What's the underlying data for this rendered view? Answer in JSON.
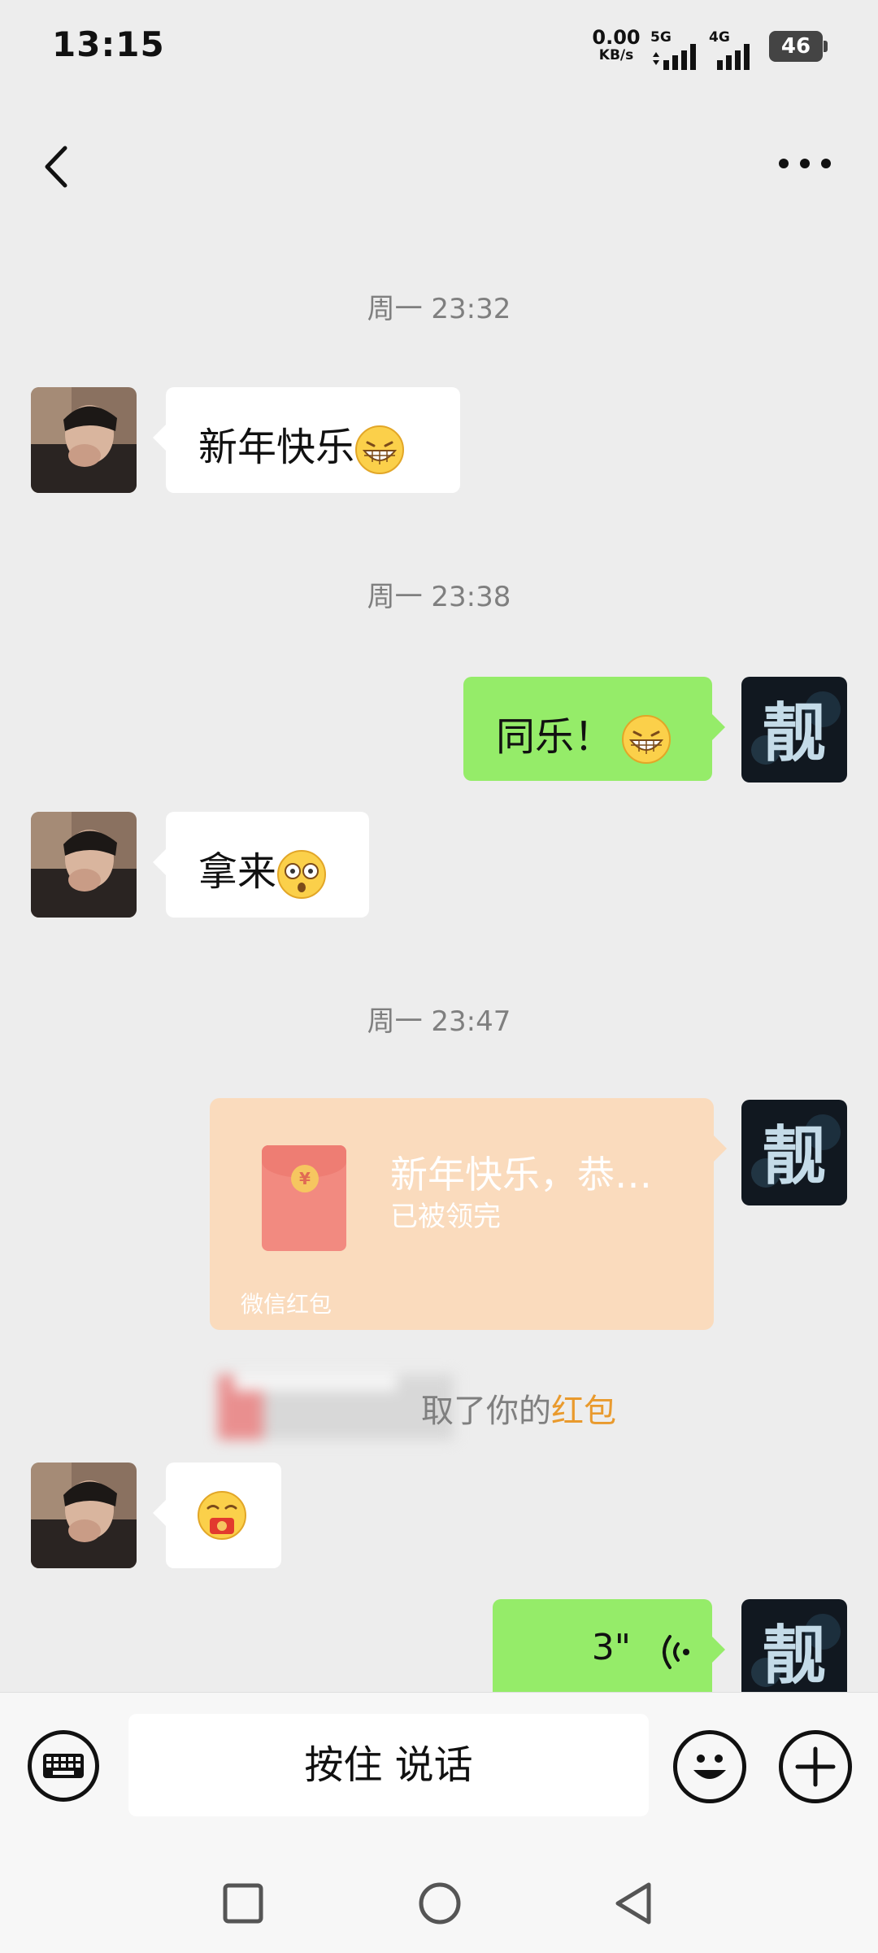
{
  "status_bar": {
    "time": "13:15",
    "net_speed_value": "0.00",
    "net_speed_unit": "KB/s",
    "signal_1_label": "5G",
    "signal_2_label": "4G",
    "battery": "46"
  },
  "header": {
    "title": ""
  },
  "messages": [
    {
      "timestamp": "周一 23:32"
    },
    {
      "side": "left",
      "text": "新年快乐",
      "emoji": "grin-emoji"
    },
    {
      "timestamp": "周一 23:38"
    },
    {
      "side": "right",
      "text": "同乐！",
      "emoji": "grin-emoji"
    },
    {
      "side": "left",
      "text": "拿来",
      "emoji": "dizzy-emoji"
    },
    {
      "timestamp": "周一 23:47"
    },
    {
      "side": "right",
      "red_packet": {
        "title": "新年快乐，恭…",
        "status": "已被领完",
        "brand": "微信红包"
      }
    },
    {
      "system": {
        "text": "取了你的",
        "link": "红包"
      }
    },
    {
      "side": "left",
      "emoji": "money-mouth-emoji"
    },
    {
      "side": "right",
      "voice": {
        "duration": "3\""
      }
    }
  ],
  "input_bar": {
    "hold_to_talk_label": "按住 说话"
  },
  "colors": {
    "background": "#ededed",
    "sent_bubble": "#95ec69",
    "received_bubble": "#ffffff",
    "red_packet": "#fadbbd",
    "link": "#e99a2d"
  }
}
